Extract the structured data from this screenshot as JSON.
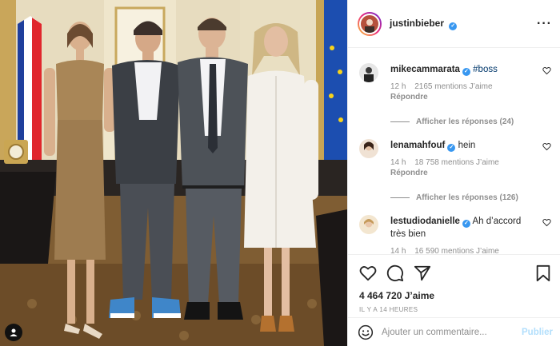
{
  "post": {
    "author": "justinbieber",
    "verified": true
  },
  "comments": [
    {
      "username": "mikecammarata",
      "verified": true,
      "text": "#boss",
      "time": "12 h",
      "likes": "2165 mentions J’aime",
      "reply_label": "Répondre",
      "show_replies": "Afficher les réponses (24)"
    },
    {
      "username": "lenamahfouf",
      "verified": true,
      "text": "hein",
      "time": "14 h",
      "likes": "18 758 mentions J’aime",
      "reply_label": "Répondre",
      "show_replies": "Afficher les réponses (126)"
    },
    {
      "username": "lestudiodanielle",
      "verified": true,
      "text": "Ah d’accord très bien",
      "time": "14 h",
      "likes": "16 590 mentions J’aime"
    }
  ],
  "actions": {
    "likes_count": "4 464 720 J’aime",
    "time_ago": "IL Y A 14 HEURES"
  },
  "composer": {
    "placeholder": "Ajouter un commentaire...",
    "publish_label": "Publier"
  },
  "icons": [
    "user-tag-icon",
    "more-options-icon",
    "heart-icon",
    "comment-icon",
    "share-icon",
    "bookmark-icon",
    "emoji-icon",
    "verified-icon"
  ],
  "colors": {
    "verified": "#3897f0",
    "link": "#00376b",
    "muted": "#8e8e8e",
    "publish_disabled": "#b2dffc"
  }
}
